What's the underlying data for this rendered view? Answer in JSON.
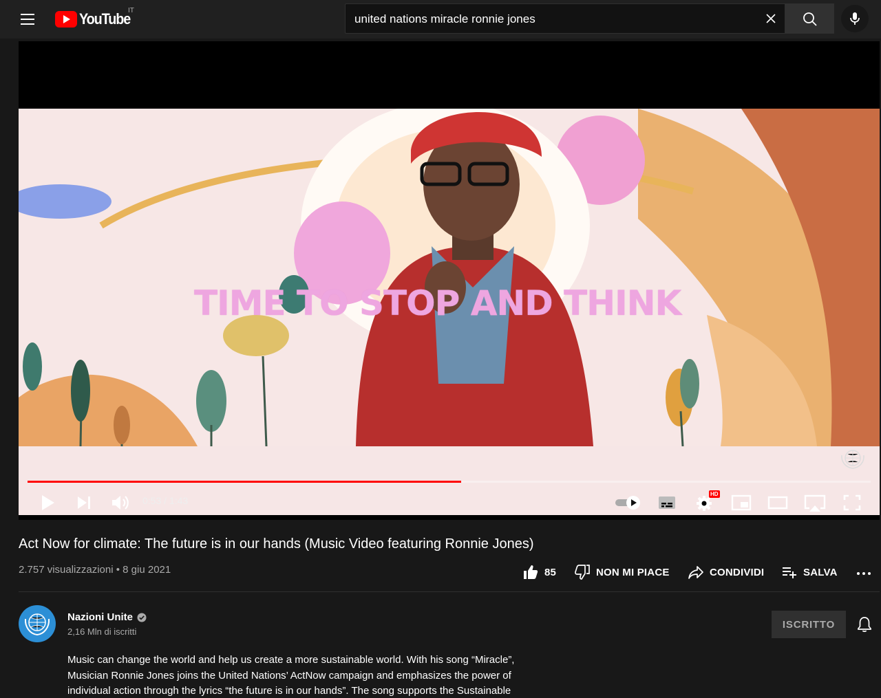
{
  "header": {
    "logo_text": "YouTube",
    "country_code": "IT",
    "search": {
      "value": "united nations miracle ronnie jones"
    }
  },
  "player": {
    "caption_text": "TIME TO STOP AND THINK",
    "current_time": "0:53",
    "duration": "1:43",
    "time_display": "0:53 / 1:43",
    "progress_fraction": 0.514,
    "hd_badge": "HD",
    "autoplay_on": true
  },
  "video": {
    "title": "Act Now for climate: The future is in our hands (Music Video featuring Ronnie Jones)",
    "views_date": "2.757 visualizzazioni • 8 giu 2021"
  },
  "actions": {
    "likes": "85",
    "dislike_label": "NON MI PIACE",
    "share_label": "CONDIVIDI",
    "save_label": "SALVA"
  },
  "channel": {
    "name": "Nazioni Unite",
    "verified": true,
    "subscribers": "2,16 Mln di iscritti",
    "subscribe_label": "ISCRITTO"
  },
  "description": {
    "lines": [
      "Music can change the world and help us create a more sustainable world. With his song “Miracle”,",
      "Musician Ronnie Jones joins the United Nations’ ActNow campaign and emphasizes the power of",
      "individual action through the lyrics “the future is in our hands”. The song supports the Sustainable"
    ]
  },
  "colors": {
    "background": "#181818",
    "topbar": "#202020",
    "brand_red": "#ff0000",
    "caption_pink": "#eea6e0",
    "un_blue": "#2c8fd6"
  }
}
